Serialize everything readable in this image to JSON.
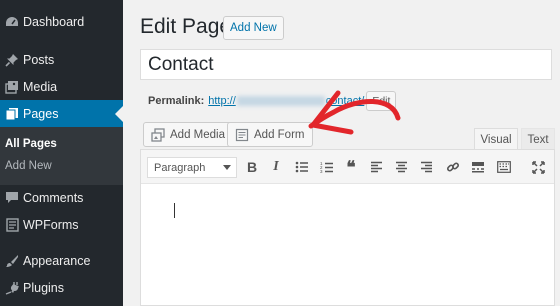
{
  "sidebar": {
    "items": [
      {
        "key": "dashboard",
        "label": "Dashboard",
        "icon": "dashboard-icon"
      },
      {
        "key": "posts",
        "label": "Posts",
        "icon": "pin-icon"
      },
      {
        "key": "media",
        "label": "Media",
        "icon": "media-icon"
      },
      {
        "key": "pages",
        "label": "Pages",
        "icon": "pages-icon",
        "active": true
      },
      {
        "key": "comments",
        "label": "Comments",
        "icon": "comment-icon"
      },
      {
        "key": "wpforms",
        "label": "WPForms",
        "icon": "form-icon"
      },
      {
        "key": "appearance",
        "label": "Appearance",
        "icon": "brush-icon"
      },
      {
        "key": "plugins",
        "label": "Plugins",
        "icon": "plug-icon"
      }
    ],
    "submenu": {
      "all_pages": "All Pages",
      "add_new": "Add New"
    }
  },
  "header": {
    "title": "Edit Page",
    "add_new_label": "Add New"
  },
  "post": {
    "title_value": "Contact"
  },
  "permalink": {
    "label": "Permalink:",
    "prefix": "http://",
    "slug": "contact/",
    "edit_label": "Edit"
  },
  "media_buttons": {
    "add_media": "Add Media",
    "add_form": "Add Form"
  },
  "editor_tabs": {
    "visual": "Visual",
    "text": "Text",
    "active": "visual"
  },
  "toolbar": {
    "format_value": "Paragraph",
    "buttons": [
      "bold-icon",
      "italic-icon",
      "bulleted-list-icon",
      "numbered-list-icon",
      "blockquote-icon",
      "align-left-icon",
      "align-center-icon",
      "align-right-icon",
      "link-icon",
      "read-more-icon",
      "toolbar-toggle-icon",
      "fullscreen-icon"
    ],
    "bold_glyph": "B",
    "italic_glyph": "I",
    "quote_glyph": "❝"
  },
  "colors": {
    "sidebar_bg": "#23282d",
    "active_bg": "#0073aa",
    "link": "#0073aa",
    "arrow": "#e2262b"
  }
}
